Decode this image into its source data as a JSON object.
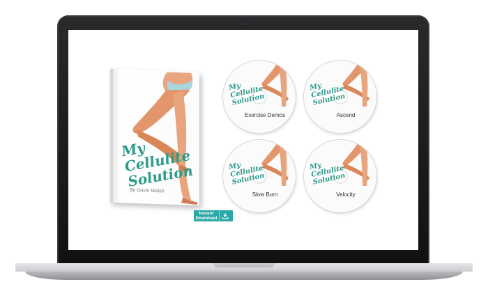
{
  "product": {
    "book": {
      "title_lines": [
        "My",
        "Cellulite",
        "Solution"
      ],
      "author": "By Gavin Walsh"
    },
    "download_badge": {
      "lines": [
        "Instant",
        "Download"
      ],
      "icon": "download-icon",
      "color": "#2aa8a8"
    },
    "discs": [
      {
        "logo_lines": [
          "My",
          "Cellulite",
          "Solution"
        ],
        "label": "Exercise Demos"
      },
      {
        "logo_lines": [
          "My",
          "Cellulite",
          "Solution"
        ],
        "label": "Ascend"
      },
      {
        "logo_lines": [
          "My",
          "Cellulite",
          "Solution"
        ],
        "label": "Slow Burn"
      },
      {
        "logo_lines": [
          "My",
          "Cellulite",
          "Solution"
        ],
        "label": "Velocity"
      }
    ],
    "brand_color": "#2d9b8c"
  }
}
